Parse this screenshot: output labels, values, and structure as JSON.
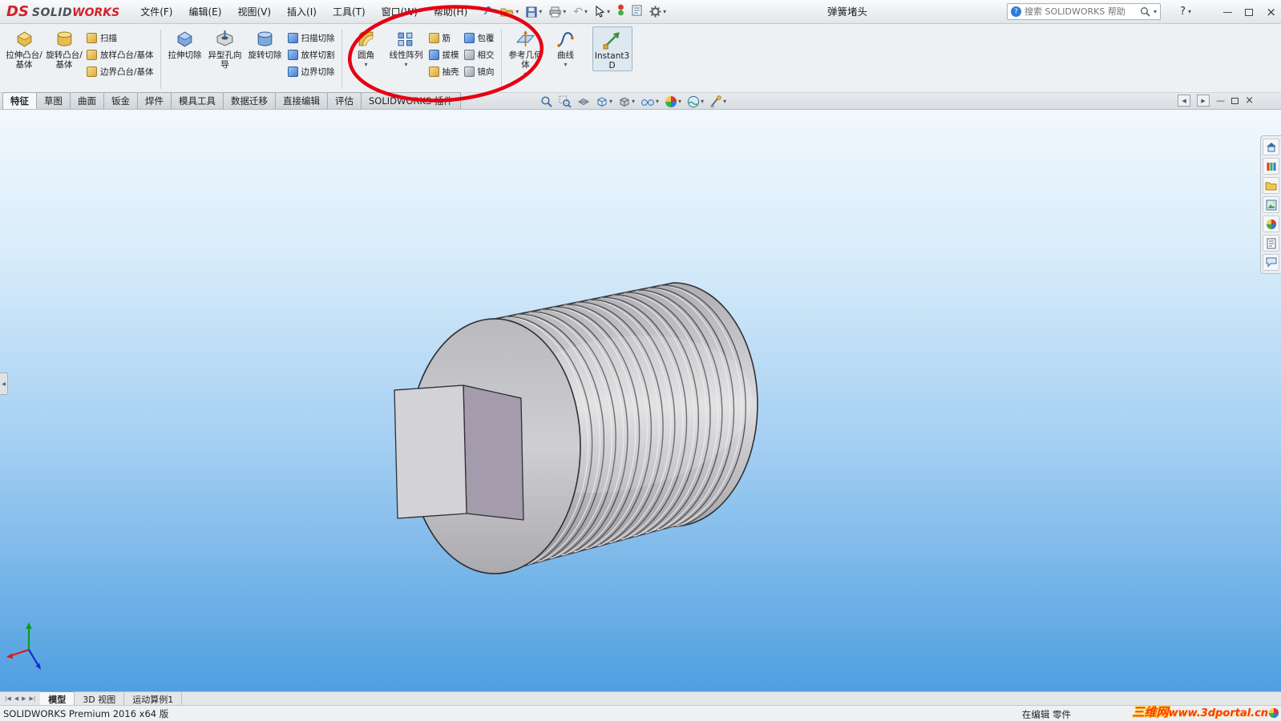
{
  "glyphs": {
    "caret": "▾",
    "minimize": "—",
    "close": "×",
    "help": "?",
    "undo": "↶",
    "first": "|◀",
    "prev": "◀",
    "next": "▶",
    "last": "▶|",
    "left_arrow": "◀",
    "right_arrow": "▶",
    "collapse_left": "◀"
  },
  "titlebar": {
    "logo": {
      "ds": "DS",
      "solid": "SOLID",
      "works": "WORKS"
    },
    "menus": [
      "文件(F)",
      "编辑(E)",
      "视图(V)",
      "插入(I)",
      "工具(T)",
      "窗口(W)",
      "帮助(H)"
    ],
    "document_title": "弹簧堵头",
    "search_placeholder": "搜索 SOLIDWORKS 帮助"
  },
  "ribbon": {
    "boss_group": {
      "large": [
        "拉伸凸台/基体",
        "旋转凸台/基体"
      ],
      "small": [
        "扫描",
        "放样凸台/基体",
        "边界凸台/基体"
      ]
    },
    "cut_group": {
      "large": [
        "拉伸切除",
        "异型孔向导",
        "旋转切除"
      ],
      "small": [
        "扫描切除",
        "放样切割",
        "边界切除"
      ]
    },
    "pattern_group": {
      "large": [
        "圆角",
        "线性阵列"
      ],
      "small_a": [
        "筋",
        "拔模",
        "抽壳"
      ],
      "small_b": [
        "包覆",
        "相交",
        "镜向"
      ]
    },
    "reference_group": {
      "large": [
        "参考几何体",
        "曲线",
        "Instant3D"
      ]
    }
  },
  "command_tabs": {
    "items": [
      "特征",
      "草图",
      "曲面",
      "钣金",
      "焊件",
      "模具工具",
      "数据迁移",
      "直接编辑",
      "评估",
      "SOLIDWORKS 插件"
    ],
    "active": "特征"
  },
  "model_tabs": {
    "items": [
      "模型",
      "3D 视图",
      "运动算例1"
    ],
    "active": "模型"
  },
  "statusbar": {
    "left": "SOLIDWORKS Premium 2016 x64 版",
    "editing_status": "在编辑 零件",
    "watermark_name": "三维网",
    "watermark_site": "www.3dportal.cn"
  }
}
